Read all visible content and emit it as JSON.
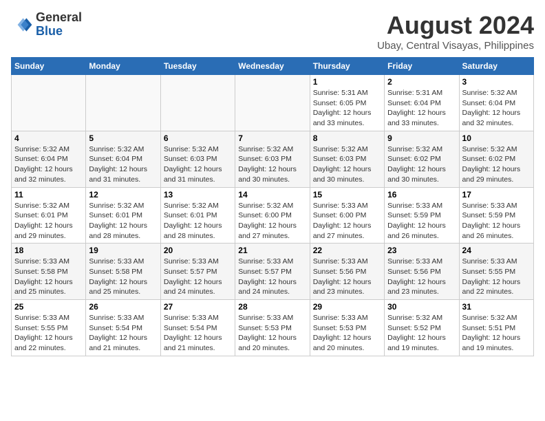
{
  "header": {
    "logo_general": "General",
    "logo_blue": "Blue",
    "month_year": "August 2024",
    "location": "Ubay, Central Visayas, Philippines"
  },
  "days_of_week": [
    "Sunday",
    "Monday",
    "Tuesday",
    "Wednesday",
    "Thursday",
    "Friday",
    "Saturday"
  ],
  "weeks": [
    [
      {
        "day": "",
        "info": ""
      },
      {
        "day": "",
        "info": ""
      },
      {
        "day": "",
        "info": ""
      },
      {
        "day": "",
        "info": ""
      },
      {
        "day": "1",
        "info": "Sunrise: 5:31 AM\nSunset: 6:05 PM\nDaylight: 12 hours\nand 33 minutes."
      },
      {
        "day": "2",
        "info": "Sunrise: 5:31 AM\nSunset: 6:04 PM\nDaylight: 12 hours\nand 33 minutes."
      },
      {
        "day": "3",
        "info": "Sunrise: 5:32 AM\nSunset: 6:04 PM\nDaylight: 12 hours\nand 32 minutes."
      }
    ],
    [
      {
        "day": "4",
        "info": "Sunrise: 5:32 AM\nSunset: 6:04 PM\nDaylight: 12 hours\nand 32 minutes."
      },
      {
        "day": "5",
        "info": "Sunrise: 5:32 AM\nSunset: 6:04 PM\nDaylight: 12 hours\nand 31 minutes."
      },
      {
        "day": "6",
        "info": "Sunrise: 5:32 AM\nSunset: 6:03 PM\nDaylight: 12 hours\nand 31 minutes."
      },
      {
        "day": "7",
        "info": "Sunrise: 5:32 AM\nSunset: 6:03 PM\nDaylight: 12 hours\nand 30 minutes."
      },
      {
        "day": "8",
        "info": "Sunrise: 5:32 AM\nSunset: 6:03 PM\nDaylight: 12 hours\nand 30 minutes."
      },
      {
        "day": "9",
        "info": "Sunrise: 5:32 AM\nSunset: 6:02 PM\nDaylight: 12 hours\nand 30 minutes."
      },
      {
        "day": "10",
        "info": "Sunrise: 5:32 AM\nSunset: 6:02 PM\nDaylight: 12 hours\nand 29 minutes."
      }
    ],
    [
      {
        "day": "11",
        "info": "Sunrise: 5:32 AM\nSunset: 6:01 PM\nDaylight: 12 hours\nand 29 minutes."
      },
      {
        "day": "12",
        "info": "Sunrise: 5:32 AM\nSunset: 6:01 PM\nDaylight: 12 hours\nand 28 minutes."
      },
      {
        "day": "13",
        "info": "Sunrise: 5:32 AM\nSunset: 6:01 PM\nDaylight: 12 hours\nand 28 minutes."
      },
      {
        "day": "14",
        "info": "Sunrise: 5:32 AM\nSunset: 6:00 PM\nDaylight: 12 hours\nand 27 minutes."
      },
      {
        "day": "15",
        "info": "Sunrise: 5:33 AM\nSunset: 6:00 PM\nDaylight: 12 hours\nand 27 minutes."
      },
      {
        "day": "16",
        "info": "Sunrise: 5:33 AM\nSunset: 5:59 PM\nDaylight: 12 hours\nand 26 minutes."
      },
      {
        "day": "17",
        "info": "Sunrise: 5:33 AM\nSunset: 5:59 PM\nDaylight: 12 hours\nand 26 minutes."
      }
    ],
    [
      {
        "day": "18",
        "info": "Sunrise: 5:33 AM\nSunset: 5:58 PM\nDaylight: 12 hours\nand 25 minutes."
      },
      {
        "day": "19",
        "info": "Sunrise: 5:33 AM\nSunset: 5:58 PM\nDaylight: 12 hours\nand 25 minutes."
      },
      {
        "day": "20",
        "info": "Sunrise: 5:33 AM\nSunset: 5:57 PM\nDaylight: 12 hours\nand 24 minutes."
      },
      {
        "day": "21",
        "info": "Sunrise: 5:33 AM\nSunset: 5:57 PM\nDaylight: 12 hours\nand 24 minutes."
      },
      {
        "day": "22",
        "info": "Sunrise: 5:33 AM\nSunset: 5:56 PM\nDaylight: 12 hours\nand 23 minutes."
      },
      {
        "day": "23",
        "info": "Sunrise: 5:33 AM\nSunset: 5:56 PM\nDaylight: 12 hours\nand 23 minutes."
      },
      {
        "day": "24",
        "info": "Sunrise: 5:33 AM\nSunset: 5:55 PM\nDaylight: 12 hours\nand 22 minutes."
      }
    ],
    [
      {
        "day": "25",
        "info": "Sunrise: 5:33 AM\nSunset: 5:55 PM\nDaylight: 12 hours\nand 22 minutes."
      },
      {
        "day": "26",
        "info": "Sunrise: 5:33 AM\nSunset: 5:54 PM\nDaylight: 12 hours\nand 21 minutes."
      },
      {
        "day": "27",
        "info": "Sunrise: 5:33 AM\nSunset: 5:54 PM\nDaylight: 12 hours\nand 21 minutes."
      },
      {
        "day": "28",
        "info": "Sunrise: 5:33 AM\nSunset: 5:53 PM\nDaylight: 12 hours\nand 20 minutes."
      },
      {
        "day": "29",
        "info": "Sunrise: 5:33 AM\nSunset: 5:53 PM\nDaylight: 12 hours\nand 20 minutes."
      },
      {
        "day": "30",
        "info": "Sunrise: 5:32 AM\nSunset: 5:52 PM\nDaylight: 12 hours\nand 19 minutes."
      },
      {
        "day": "31",
        "info": "Sunrise: 5:32 AM\nSunset: 5:51 PM\nDaylight: 12 hours\nand 19 minutes."
      }
    ]
  ]
}
